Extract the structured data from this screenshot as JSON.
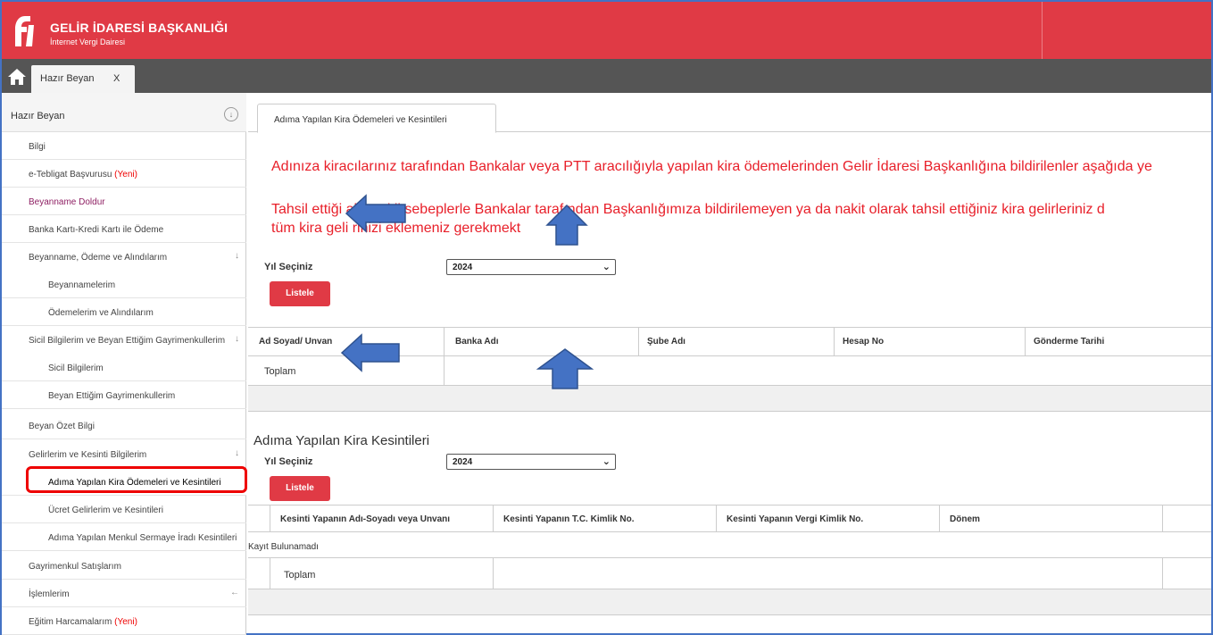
{
  "header": {
    "title": "GELİR İDARESİ BAŞKANLIĞI",
    "subtitle": "İnternet Vergi Dairesi"
  },
  "tabs": {
    "home_icon": "home-icon",
    "open_tab_label": "Hazır Beyan",
    "open_tab_close": "X"
  },
  "sidebar": {
    "section_title": "Hazır Beyan",
    "collapse_icon": "↓",
    "items": [
      {
        "label": "Bilgi",
        "new": ""
      },
      {
        "label": "e-Tebligat Başvurusu ",
        "new": "(Yeni)"
      },
      {
        "label": "Beyanname Doldur",
        "new": ""
      },
      {
        "label": "Banka Kartı-Kredi Kartı ile Ödeme",
        "new": ""
      },
      {
        "label": "Beyanname, Ödeme ve Alındılarım",
        "new": ""
      },
      {
        "label": "Beyannamelerim",
        "new": ""
      },
      {
        "label": "Ödemelerim ve Alındılarım",
        "new": ""
      },
      {
        "label": "Sicil Bilgilerim ve Beyan Ettiğim Gayrimenkullerim",
        "new": ""
      },
      {
        "label": "Sicil Bilgilerim",
        "new": ""
      },
      {
        "label": "Beyan Ettiğim Gayrimenkullerim",
        "new": ""
      },
      {
        "label": "Beyan Özet Bilgi",
        "new": ""
      },
      {
        "label": "Gelirlerim ve Kesinti Bilgilerim",
        "new": ""
      },
      {
        "label": "Adıma Yapılan Kira Ödemeleri ve Kesintileri",
        "new": ""
      },
      {
        "label": "Ücret Gelirlerim ve Kesintileri",
        "new": ""
      },
      {
        "label": "Adıma Yapılan Menkul Sermaye İradı Kesintileri",
        "new": ""
      },
      {
        "label": "Gayrimenkul Satışlarım",
        "new": ""
      },
      {
        "label": "İşlemlerim",
        "new": ""
      },
      {
        "label": "Eğitim Harcamalarım ",
        "new": "(Yeni)"
      }
    ],
    "down_arrow": "↓",
    "left_arrow": "←"
  },
  "main": {
    "tab_label": "Adıma Yapılan Kira Ödemeleri ve Kesintileri",
    "info_line1": "Adınıza kiracılarınız tarafından Bankalar veya PTT aracılığıyla yapılan kira ödemelerinden Gelir İdaresi Başkanlığına bildirilenler aşağıda ye",
    "info_line2": "Tahsil ettiği         ak çeşitli sebeplerle Bankalar tarafından Başkanlığımıza bildirilemeyen ya da nakit olarak tahsil ettiğiniz kira gelirleriniz d",
    "info_line3": "tüm kira geli         rinizi eklemeniz gerekmekt",
    "year_label": "Yıl Seçiniz",
    "year_value": "2024",
    "list_button": "Listele",
    "table1": {
      "headers": [
        "Ad Soyad/ Unvan",
        "Banka Adı",
        "Şube Adı",
        "Hesap No",
        "Gönderme Tarihi"
      ],
      "total_label": "Toplam"
    },
    "section2_title": "Adıma Yapılan Kira Kesintileri",
    "year_label2": "Yıl Seçiniz",
    "year_value2": "2024",
    "list_button2": "Listele",
    "table2": {
      "headers": [
        "Kesinti Yapanın Adı-Soyadı veya Unvanı",
        "Kesinti Yapanın T.C. Kimlik No.",
        "Kesinti Yapanın Vergi Kimlik No.",
        "Dönem"
      ],
      "empty_text": "Kayıt Bulunamadı",
      "total_label": "Toplam"
    }
  },
  "colors": {
    "brand_red": "#e03a45",
    "info_red": "#e8202a",
    "annotation_blue": "#4472c4",
    "highlight_red": "#ee0000"
  }
}
